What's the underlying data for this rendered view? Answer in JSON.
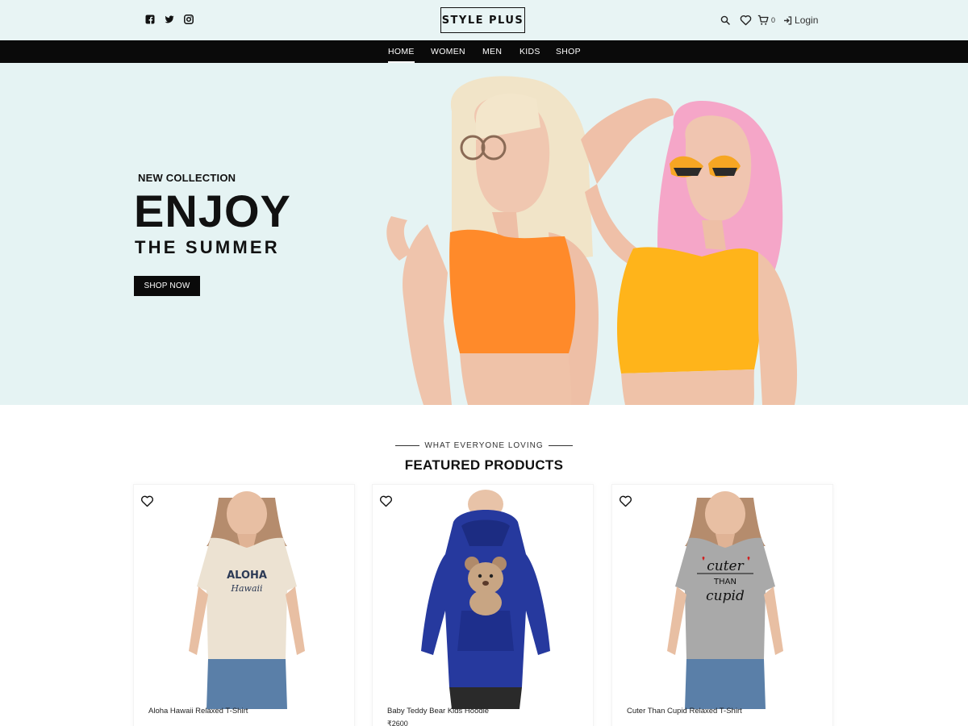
{
  "header": {
    "social": [
      "facebook-icon",
      "twitter-icon",
      "instagram-icon"
    ],
    "logo": "STYLE PLUS",
    "cart_count": "0",
    "login_label": "Login",
    "icons": [
      "search-icon",
      "heart-icon",
      "cart-icon",
      "login-icon"
    ]
  },
  "nav": {
    "items": [
      "HOME",
      "WOMEN",
      "MEN",
      "KIDS",
      "SHOP"
    ],
    "active": "HOME"
  },
  "hero": {
    "subtitle": "NEW COLLECTION",
    "title": "ENJOY",
    "title2": "THE SUMMER",
    "button": "SHOP NOW"
  },
  "featured": {
    "eyebrow": "WHAT EVERYONE LOVING",
    "title": "FEATURED PRODUCTS",
    "products": [
      {
        "name": "Aloha Hawaii Relaxed T-Shirt",
        "price": ""
      },
      {
        "name": "Baby Teddy Bear Kids Hoodie",
        "price": "₹2600"
      },
      {
        "name": "Cuter Than Cupid Relaxed T-Shirt",
        "price": ""
      }
    ]
  },
  "colors": {
    "header_bg": "#e8f4f4",
    "nav_bg": "#0a0a0a",
    "hero_bg": "#e5f3f3",
    "accent": "#111111"
  }
}
